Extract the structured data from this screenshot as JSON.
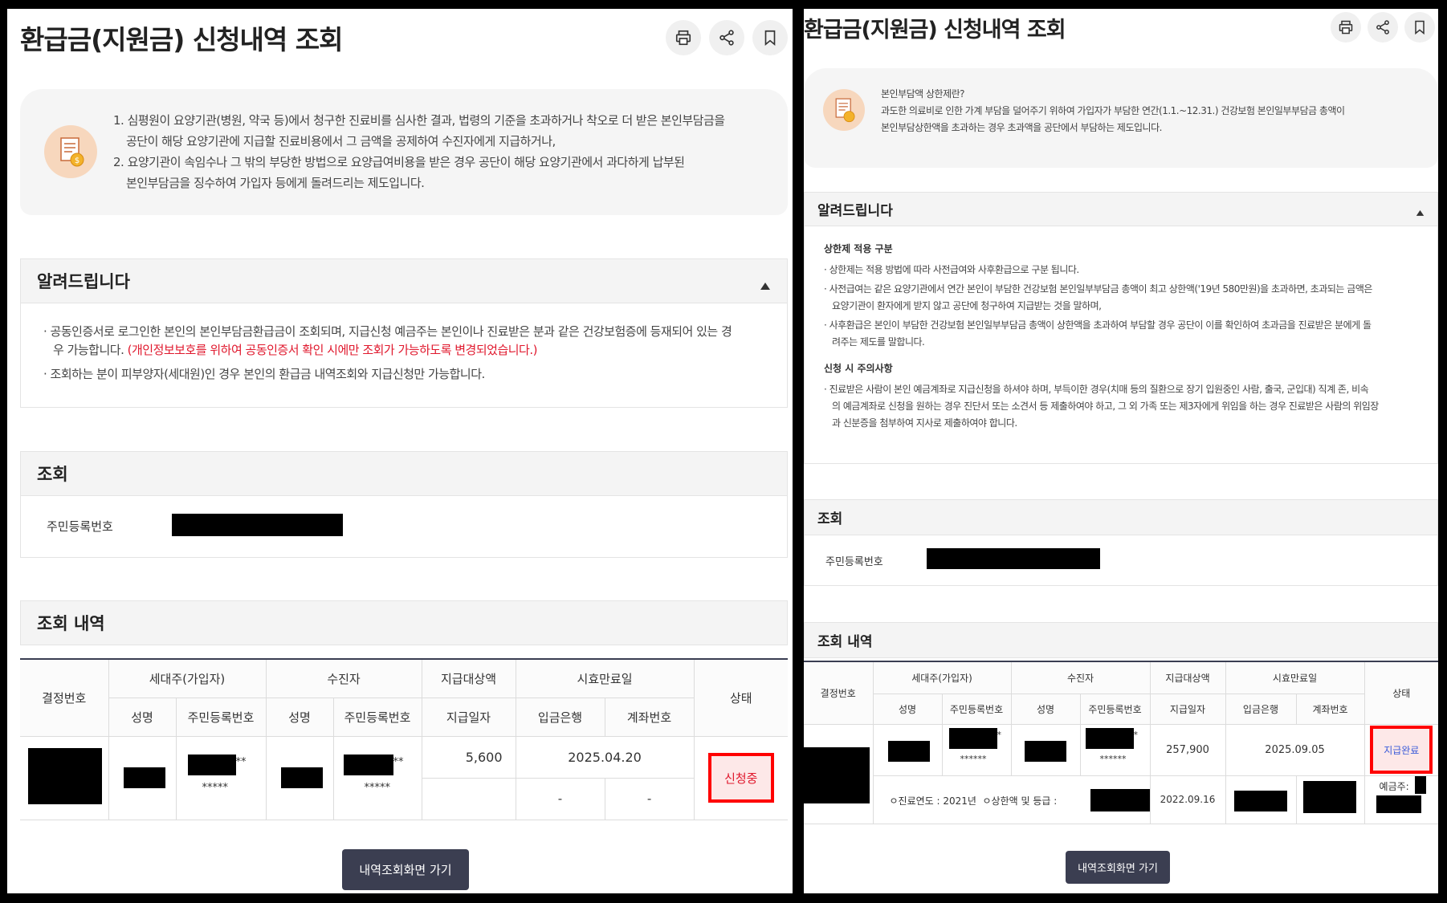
{
  "left": {
    "title": "환급금(지원금) 신청내역 조회",
    "intro": [
      "1. 심평원이 요양기관(병원, 약국 등)에서 청구한 진료비를 심사한 결과, 법령의 기준을 초과하거나 착오로 더 받은 본인부담금을",
      "공단이 해당 요양기관에 지급할 진료비용에서 그 금액을 공제하여 수진자에게 지급하거나,",
      "2. 요양기관이 속임수나 그 밖의 부당한 방법으로 요양급여비용을 받은 경우 공단이 해당 요양기관에서 과다하게 납부된",
      "본인부담금을 징수하여 가입자 등에게 돌려드리는 제도입니다."
    ],
    "notice": {
      "heading": "알려드립니다",
      "b1_line1": "공동인증서로 로그인한 본인의 본인부담금환급금이 조회되며, 지급신청 예금주는 본인이나 진료받은 분과 같은 건강보험증에 등재되어 있는 경",
      "b1_line2": "우 가능합니다.",
      "b1_red": "(개인정보보호를 위하여 공동인증서 확인 시에만 조회가 가능하도록 변경되었습니다.)",
      "b2": "조회하는 분이 피부양자(세대원)인 경우 본인의 환급금 내역조회와 지급신청만 가능합니다."
    },
    "query": {
      "heading": "조회",
      "label": "주민등록번호"
    },
    "results": {
      "heading": "조회 내역"
    },
    "row": {
      "masked1": "**",
      "masked2": "*****",
      "amount": "5,600",
      "date": "2025.04.20",
      "bank": "-",
      "account": "-",
      "status": "신청중"
    },
    "go_button": "내역조회화면 가기"
  },
  "right": {
    "title": "환급금(지원금) 신청내역 조회",
    "intro": [
      "본인부담액 상한제란?",
      "과도한 의료비로 인한 가계 부담을 덜어주기 위하여 가입자가 부담한 연간(1.1.~12.31.) 건강보험 본인일부부담금 총액이",
      "본인부담상한액을 초과하는 경우 초과액을 공단에서 부담하는 제도입니다."
    ],
    "notice": {
      "heading": "알려드립니다",
      "sub1": "상한제 적용 구분",
      "s1b1": "상한제는 적용 방법에 따라 사전급여와 사후환급으로 구분 됩니다.",
      "s1b2_l1": "사전급여는 같은 요양기관에서 연간 본인이 부담한 건강보험 본인일부부담금 총액이 최고 상한액('19년 580만원)을 초과하면, 초과되는 금액은",
      "s1b2_l2": "요양기관이 환자에게 받지 않고 공단에 청구하여 지급받는 것을 말하며,",
      "s1b3_l1": "사후환급은 본인이 부담한 건강보험 본인일부부담금 총액이 상한액을 초과하여 부담할 경우 공단이 이를 확인하여 초과금을 진료받은 분에게 돌",
      "s1b3_l2": "려주는 제도를 말합니다.",
      "sub2": "신청 시 주의사항",
      "s2b1_l1": "진료받은 사람이 본인 예금계좌로 지급신청을 하셔야 하며, 부득이한 경우(치매 등의 질환으로 장기 입원중인 사람, 출국, 군입대) 직계 존, 비속",
      "s2b1_l2": "의 예금계좌로 신청을 원하는 경우 진단서 또는 소견서 등 제출하여야 하고, 그 외 가족 또는 제3자에게 위임을 하는 경우 진료받은 사람의 위임장",
      "s2b1_l3": "과 신분증을 첨부하여 지사로 제출하여야 합니다."
    },
    "query": {
      "heading": "조회",
      "label": "주민등록번호"
    },
    "results": {
      "heading": "조회 내역"
    },
    "row": {
      "masked1": "*",
      "masked2": "******",
      "amount": "257,900",
      "date": "2025.09.05",
      "year_label": "ㅇ진료연도 : 2021년",
      "grade_label": "ㅇ상한액 및 등급 :",
      "pay_date": "2022.09.16",
      "status": "지급완료",
      "depositor": "예금주:"
    },
    "go_button": "내역조회화면 가기"
  },
  "headers": {
    "decision_no": "결정번호",
    "household": "세대주(가입자)",
    "patient": "수진자",
    "amount": "지급대상액",
    "expiry": "시효만료일",
    "status": "상태",
    "name": "성명",
    "rrn": "주민등록번호",
    "pay_date": "지급일자",
    "bank": "입금은행",
    "account": "계좌번호"
  },
  "icons": [
    "print-icon",
    "share-icon",
    "bookmark-icon",
    "document-coin-icon",
    "collapse-arrow-icon"
  ],
  "colors": {
    "accent_red": "#e0182d",
    "button_dark": "#3b3e51",
    "highlight_border": "#ff0000",
    "status_blue": "#3a5bd9"
  }
}
